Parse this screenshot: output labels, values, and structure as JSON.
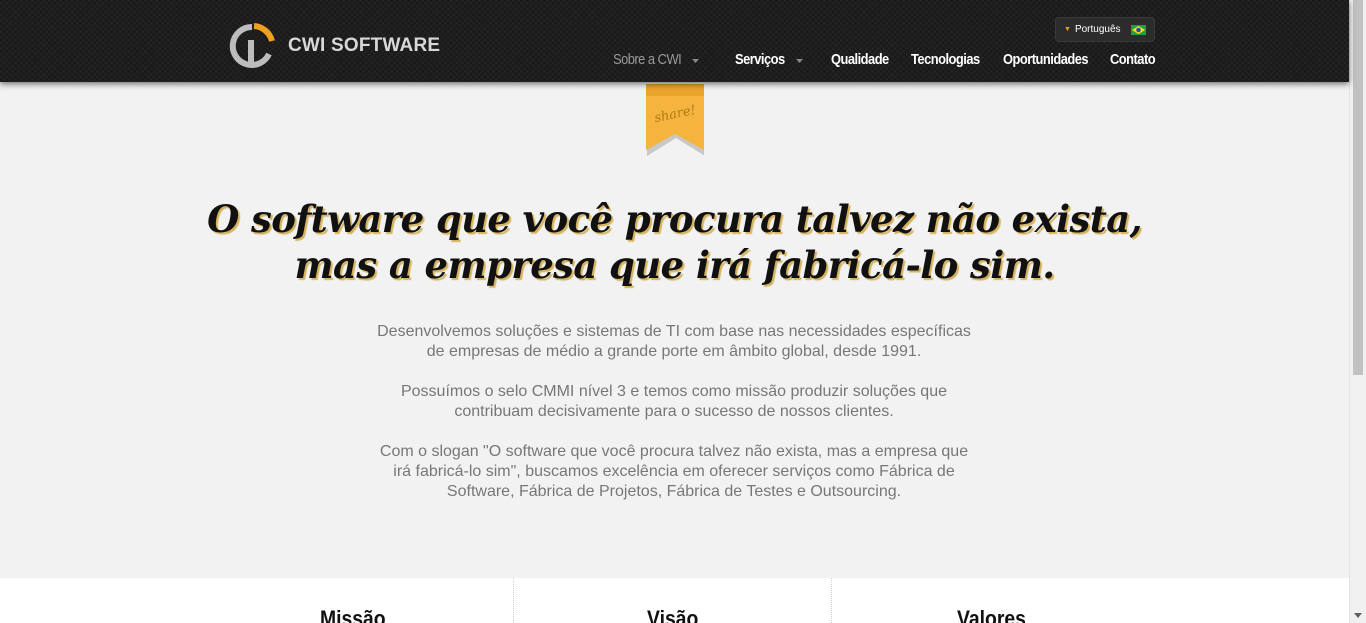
{
  "brand": {
    "name": "CWI SOFTWARE",
    "accent": "#f0a020"
  },
  "language": {
    "label": "Português",
    "flag": "brazil-flag-icon"
  },
  "nav": [
    {
      "label": "Sobre a CWI",
      "dropdown": true,
      "active": false
    },
    {
      "label": "Serviços",
      "dropdown": true,
      "active": true
    },
    {
      "label": "Qualidade",
      "dropdown": false,
      "active": true
    },
    {
      "label": "Tecnologias",
      "dropdown": false,
      "active": true
    },
    {
      "label": "Oportunidades",
      "dropdown": false,
      "active": true
    },
    {
      "label": "Contato",
      "dropdown": false,
      "active": true
    }
  ],
  "ribbon": {
    "label": "share!"
  },
  "hero": {
    "line1": "O software que você procura talvez não exista,",
    "line2": "mas a empresa que irá fabricá-lo sim."
  },
  "paragraphs": [
    "Desenvolvemos soluções e sistemas de TI com base nas necessidades específicas de empresas de médio a grande porte em âmbito global, desde 1991.",
    "Possuímos o selo CMMI nível 3 e temos como missão produzir soluções que contribuam decisivamente para o sucesso de nossos clientes.",
    "Com o slogan \"O software que você procura talvez não exista, mas a empresa que irá fabricá-lo sim\", buscamos excelência em oferecer serviços como Fábrica de Software, Fábrica de Projetos, Fábrica de Testes e Outsourcing."
  ],
  "columns": [
    "Missão",
    "Visão",
    "Valores"
  ]
}
